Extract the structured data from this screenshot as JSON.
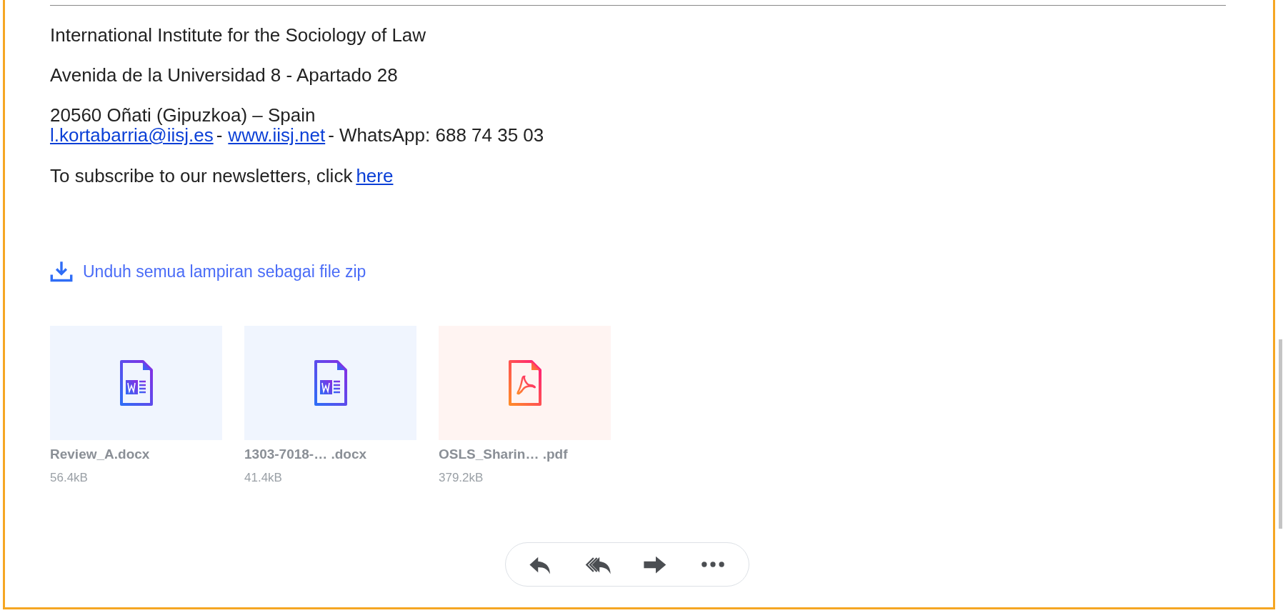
{
  "signature": {
    "lines": [
      "International Institute for the Sociology of Law",
      "Avenida de la Universidad 8 - Apartado 28",
      "20560 Oñati (Gipuzkoa) – Spain"
    ],
    "contact": {
      "email": "l.kortabarria@iisj.es",
      "separator": "-",
      "website": "www.iisj.net",
      "whatsapp": "- WhatsApp: 688 74 35 03"
    },
    "subscribe": {
      "text": "To subscribe to our newsletters, click",
      "link": "here"
    }
  },
  "download_all": "Unduh semua lampiran sebagai file zip",
  "attachments": [
    {
      "kind": "word",
      "name": "Review_A.docx",
      "size": "56.4kB"
    },
    {
      "kind": "word",
      "name": "1303-7018-… .docx",
      "size": "41.4kB"
    },
    {
      "kind": "pdf",
      "name": "OSLS_Sharin… .pdf",
      "size": "379.2kB"
    }
  ],
  "actions": [
    {
      "kind": "reply"
    },
    {
      "kind": "reply-all"
    },
    {
      "kind": "forward"
    },
    {
      "kind": "more"
    }
  ]
}
